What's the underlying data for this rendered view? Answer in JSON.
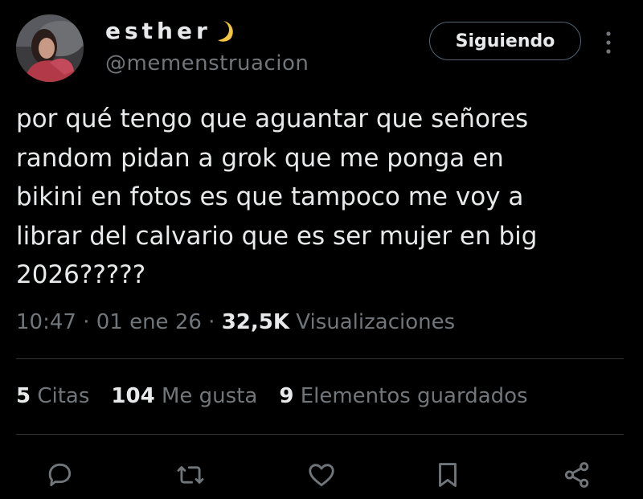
{
  "user": {
    "display_name": "esther",
    "handle": "@memenstruacion",
    "avatar_icon": "profile-avatar",
    "name_emoji_icon": "crescent-moon-icon"
  },
  "follow_button": {
    "label": "Siguiendo"
  },
  "menu": {
    "icon": "more-vertical-icon"
  },
  "tweet": {
    "text": "por qué tengo que aguantar que señores\nrandom pidan a grok que me ponga en\nbikini en fotos es que tampoco me voy a\nlibrar del calvario que es ser mujer en big\n2026?????",
    "time": "10:47",
    "date": "01 ene 26",
    "views_count": "32,5K",
    "views_label": "Visualizaciones"
  },
  "stats": {
    "quotes_count": "5",
    "quotes_label": "Citas",
    "likes_count": "104",
    "likes_label": "Me gusta",
    "bookmarks_count": "9",
    "bookmarks_label": "Elementos guardados"
  },
  "actions": [
    "reply-icon",
    "retweet-icon",
    "like-icon",
    "bookmark-icon",
    "share-icon"
  ],
  "colors": {
    "background": "#000000",
    "text": "#e7e9ea",
    "secondary": "#71767b",
    "divider": "#2f3336"
  }
}
